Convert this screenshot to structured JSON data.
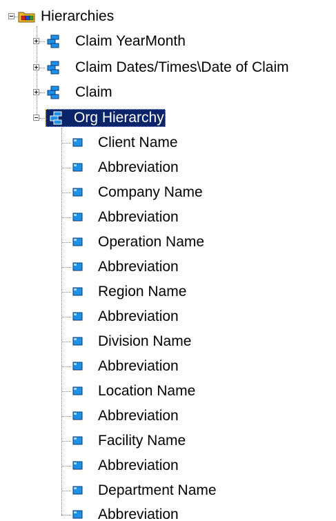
{
  "tree": {
    "root": {
      "label": "Hierarchies",
      "icon": "folder-cube-icon",
      "expanded": true
    },
    "hierarchies": [
      {
        "label": "Claim YearMonth",
        "icon": "hierarchy-icon",
        "expanded": false
      },
      {
        "label": "Claim Dates/Times\\Date of Claim",
        "icon": "hierarchy-icon",
        "expanded": false
      },
      {
        "label": "Claim",
        "icon": "hierarchy-icon",
        "expanded": false
      },
      {
        "label": "Org Hierarchy",
        "icon": "hierarchy-icon",
        "expanded": true,
        "selected": true
      }
    ],
    "levels": [
      {
        "label": "Client Name"
      },
      {
        "label": "Abbreviation"
      },
      {
        "label": "Company Name"
      },
      {
        "label": "Abbreviation"
      },
      {
        "label": "Operation Name"
      },
      {
        "label": "Abbreviation"
      },
      {
        "label": "Region Name"
      },
      {
        "label": "Abbreviation"
      },
      {
        "label": "Division Name"
      },
      {
        "label": "Abbreviation"
      },
      {
        "label": "Location Name"
      },
      {
        "label": "Abbreviation"
      },
      {
        "label": "Facility Name"
      },
      {
        "label": "Abbreviation"
      },
      {
        "label": "Department Name"
      },
      {
        "label": "Abbreviation"
      }
    ],
    "colors": {
      "selection_bg": "#0a246a",
      "selection_text": "#ffffff",
      "level_icon": "#1e90e6",
      "folder": "#e8b830"
    }
  }
}
